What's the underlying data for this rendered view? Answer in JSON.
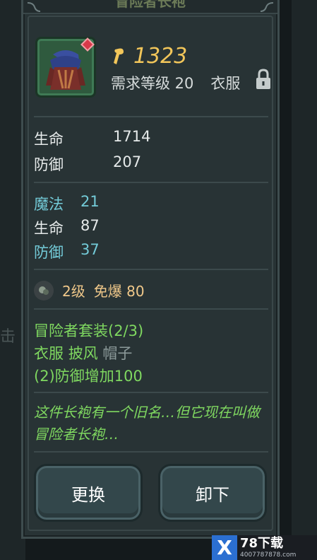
{
  "background": {
    "left_char": "击"
  },
  "panel": {
    "title": "冒险者长袍"
  },
  "item": {
    "icon": "robe-icon",
    "price": "1323",
    "required_level": "需求等级 20",
    "category": "衣服",
    "locked_icon": "lock-icon"
  },
  "base_stats": [
    {
      "label": "生命",
      "value": "1714"
    },
    {
      "label": "防御",
      "value": "207"
    }
  ],
  "bonus_stats": [
    {
      "label": "魔法",
      "value": "21"
    },
    {
      "label": "生命",
      "value": "87"
    },
    {
      "label": "防御",
      "value": "37"
    }
  ],
  "socket": {
    "level": "2级",
    "immune": "免爆 80"
  },
  "set": {
    "name": "冒险者套装(2/3)",
    "owned_1": "衣服",
    "owned_2": "披风",
    "missing": "帽子",
    "bonus": "(2)防御增加100"
  },
  "flavor_text": "这件长袍有一个旧名…但它现在叫做冒险者长袍…",
  "buttons": {
    "replace": "更换",
    "unequip": "卸下"
  },
  "watermark": {
    "brand": "78下载",
    "url": "400778787​8.com"
  },
  "colors": {
    "price": "#f2c65a",
    "bonus_stat": "#73cbd8",
    "set_text": "#7fd860",
    "socket_text": "#f0c88a"
  }
}
